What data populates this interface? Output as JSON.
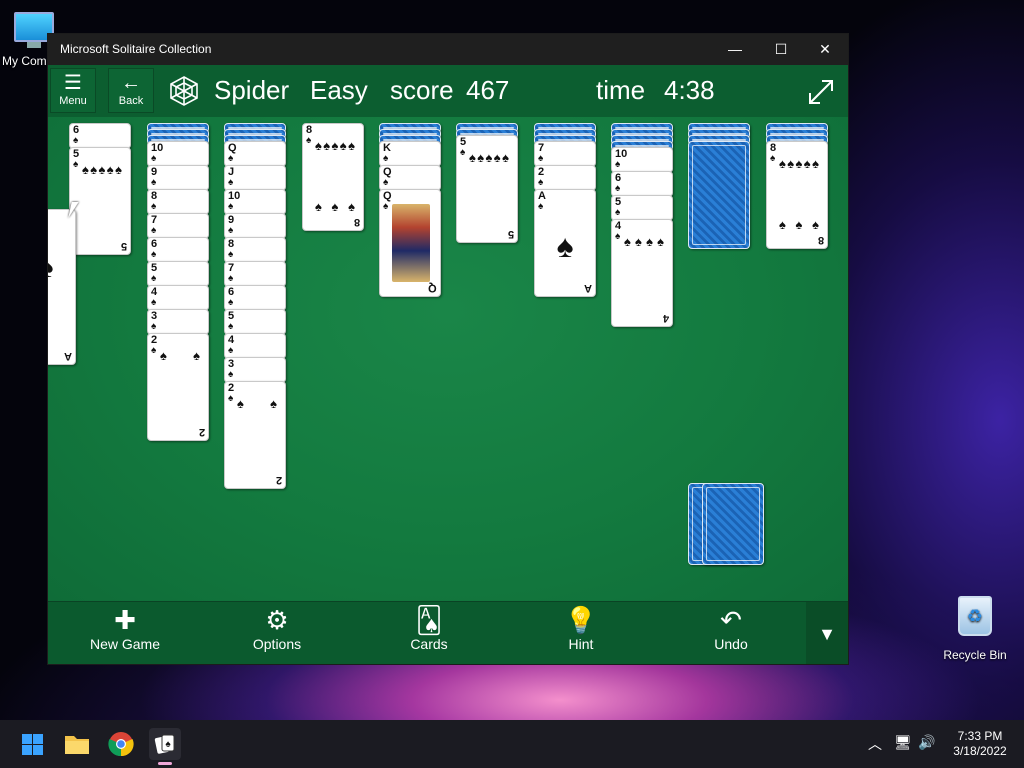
{
  "desktop": {
    "my_computer_label": "My Com",
    "recycle_bin_label": "Recycle Bin"
  },
  "window": {
    "title": "Microsoft Solitaire Collection",
    "min_glyph": "—",
    "max_glyph": "☐",
    "close_glyph": "✕"
  },
  "header": {
    "menu_label": "Menu",
    "back_label": "Back",
    "game_name": "Spider",
    "difficulty": "Easy",
    "score_label": "score",
    "score_value": "467",
    "time_label": "time",
    "time_value": "4:38"
  },
  "tableau": [
    {
      "facedown": 0,
      "faceup": [
        "6",
        "5"
      ]
    },
    {
      "facedown": 3,
      "faceup": [
        "10",
        "9",
        "8",
        "7",
        "6",
        "5",
        "4",
        "3",
        "2"
      ]
    },
    {
      "facedown": 3,
      "faceup": [
        "Q",
        "J",
        "10",
        "9",
        "8",
        "7",
        "6",
        "5",
        "4",
        "3",
        "2"
      ]
    },
    {
      "facedown": 0,
      "faceup": [
        "8"
      ]
    },
    {
      "facedown": 3,
      "faceup": [
        "K",
        "Q",
        "Q"
      ]
    },
    {
      "facedown": 2,
      "faceup": [
        "5"
      ]
    },
    {
      "facedown": 3,
      "faceup": [
        "7",
        "2",
        "A"
      ]
    },
    {
      "facedown": 4,
      "faceup": [
        "10",
        "6",
        "5",
        "4"
      ]
    },
    {
      "facedown": 4,
      "faceup": []
    },
    {
      "facedown": 3,
      "faceup": [
        "8"
      ]
    }
  ],
  "dragged_card": {
    "rank": "A",
    "suit": "♠"
  },
  "suit": "♠",
  "stock": {
    "piles": 2
  },
  "toolbar": {
    "new_game": "New Game",
    "options": "Options",
    "cards": "Cards",
    "hint": "Hint",
    "undo": "Undo"
  },
  "taskbar": {
    "time": "7:33 PM",
    "date": "3/18/2022"
  },
  "colors": {
    "felt": "#137a3f",
    "header": "#0c5e30",
    "card_back": "#2a7fd6"
  }
}
